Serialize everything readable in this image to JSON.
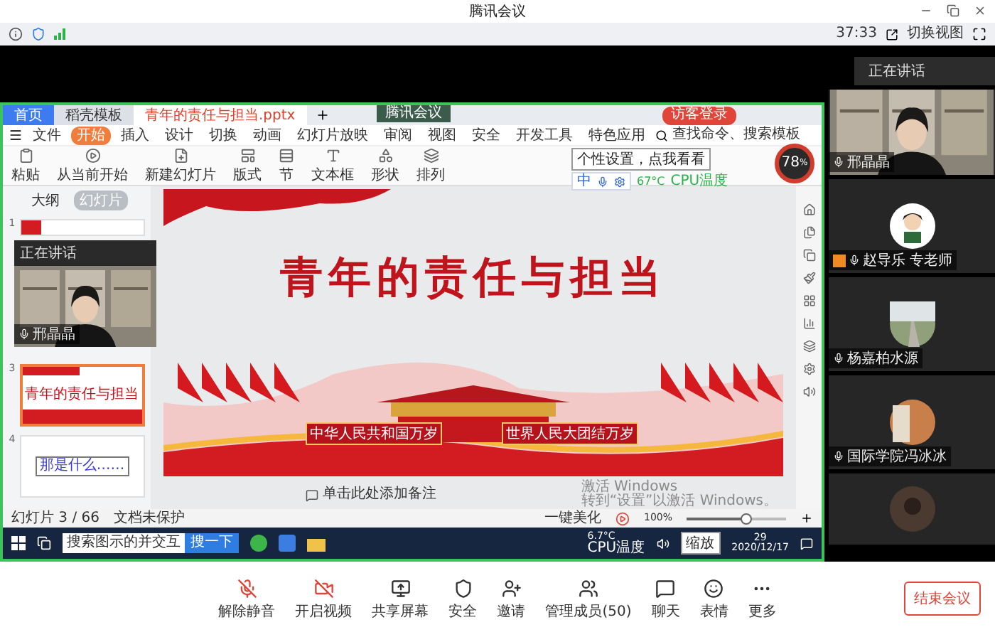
{
  "window": {
    "title": "腾讯会议"
  },
  "meeting_bar": {
    "duration": "37:33",
    "view_switch": "切换视图"
  },
  "share": {
    "tag": "腾讯会议",
    "app_tabs": [
      {
        "label": "首页",
        "kind": "home",
        "selected": false
      },
      {
        "label": "稻壳模板",
        "kind": "doc",
        "selected": false
      },
      {
        "label": "青年的责任与担当.pptx",
        "kind": "doc",
        "selected": true
      }
    ],
    "login": "访客登录",
    "menu": [
      {
        "label": "文件",
        "selected": false
      },
      {
        "label": "开始",
        "selected": true
      },
      {
        "label": "插入",
        "selected": false
      },
      {
        "label": "设计",
        "selected": false
      },
      {
        "label": "切换",
        "selected": false
      },
      {
        "label": "动画",
        "selected": false
      },
      {
        "label": "幻灯片放映",
        "selected": false
      },
      {
        "label": "审阅",
        "selected": false
      },
      {
        "label": "视图",
        "selected": false
      },
      {
        "label": "安全",
        "selected": false
      },
      {
        "label": "开发工具",
        "selected": false
      },
      {
        "label": "特色应用",
        "selected": false
      }
    ],
    "search": "查找命令、搜索模板",
    "cpu": {
      "percent": "78",
      "unit": "%",
      "temp": "67°C",
      "label": "CPU温度"
    },
    "tooltip": "个性设置，点我看看",
    "ime": "中",
    "ribbon": [
      {
        "label": "粘贴",
        "kind": "paste"
      },
      {
        "label": "从当前开始",
        "kind": "play"
      },
      {
        "label": "新建幻灯片",
        "kind": "new"
      },
      {
        "label": "版式",
        "kind": "layout"
      },
      {
        "label": "节",
        "kind": "section"
      },
      {
        "label": "文本框",
        "kind": "text"
      },
      {
        "label": "形状",
        "kind": "shape"
      },
      {
        "label": "排列",
        "kind": "arrange"
      }
    ],
    "panel_tabs": [
      {
        "label": "大纲",
        "selected": false
      },
      {
        "label": "幻灯片",
        "selected": true
      }
    ],
    "thumbnails": [
      {
        "number": "1",
        "kind": "cover",
        "selected": false
      },
      {
        "number": "3",
        "kind": "title",
        "text": "青年的责任与担当",
        "selected": true
      },
      {
        "number": "4",
        "kind": "question",
        "text": "那是什么……",
        "selected": false
      }
    ],
    "floating_video": {
      "header": "正在讲话",
      "name": "邢晶晶"
    },
    "slide": {
      "title": "青年的责任与担当",
      "banners": [
        "中华人民共和国万岁",
        "世界人民大团结万岁"
      ]
    },
    "notes_placeholder": "单击此处添加备注",
    "activation": [
      "激活 Windows",
      "转到“设置”以激活 Windows。"
    ],
    "status": {
      "slide_count": "幻灯片 3 / 66",
      "protection": "文档未保护",
      "beautify": "一键美化",
      "zoom": "100%",
      "level": 0.6
    },
    "taskbar": {
      "search": "搜索图示的并交互",
      "search_button": "搜一下",
      "temp": "6.7°C",
      "cpu_label": "CPU温度",
      "tooltip": "缩放",
      "time": "29",
      "date": "2020/12/17"
    }
  },
  "side": {
    "header": "正在讲话",
    "speaker": "邢晶晶",
    "participants": [
      {
        "name": "赵导乐 专老师",
        "host": true,
        "kind": "cartoon"
      },
      {
        "name": "杨嘉柏水源",
        "host": false,
        "kind": "road"
      },
      {
        "name": "国际学院冯冰冰",
        "host": false,
        "kind": "paper"
      },
      {
        "kind": "dark"
      }
    ]
  },
  "toolbar": [
    {
      "label": "解除静音",
      "kind": "mic"
    },
    {
      "label": "开启视频",
      "kind": "video"
    },
    {
      "label": "共享屏幕",
      "kind": "share"
    },
    {
      "label": "安全",
      "kind": "security"
    },
    {
      "label": "邀请",
      "kind": "invite"
    },
    {
      "label": "管理成员(50)",
      "kind": "members"
    },
    {
      "label": "聊天",
      "kind": "chat"
    },
    {
      "label": "表情",
      "kind": "emoji"
    },
    {
      "label": "更多",
      "kind": "more"
    }
  ],
  "end_button": "结束会议"
}
